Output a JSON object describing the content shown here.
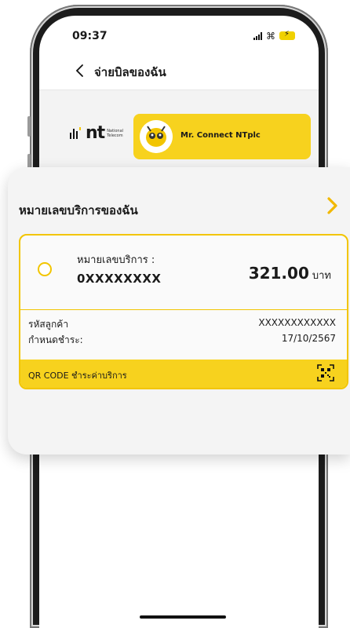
{
  "status_bar": {
    "time": "09:37"
  },
  "header": {
    "title": "จ่ายบิลของฉัน"
  },
  "provider": {
    "logo_text": "nt",
    "logo_sub_line1": "National",
    "logo_sub_line2": "Telecom",
    "account_name": "Mr. Connect NTplc"
  },
  "section": {
    "title": "หมายเลขบริการของฉัน"
  },
  "bill": {
    "service_label": "หมายเลขบริการ :",
    "service_number": "0XXXXXXXX",
    "amount": "321.00",
    "currency": "บาท",
    "customer_id_label": "รหัสลูกค้า",
    "customer_id_value": "XXXXXXXXXXXX",
    "due_label": "กำหนดชำระ:",
    "due_value": "17/10/2567",
    "qr_label": "QR CODE ชำระค่าบริการ"
  },
  "colors": {
    "accent": "#f7d21e",
    "border": "#f2c500"
  },
  "icons": [
    "back-chevron-icon",
    "chevron-right-icon",
    "qr-code-icon",
    "wifi-icon",
    "signal-icon",
    "battery-icon"
  ]
}
